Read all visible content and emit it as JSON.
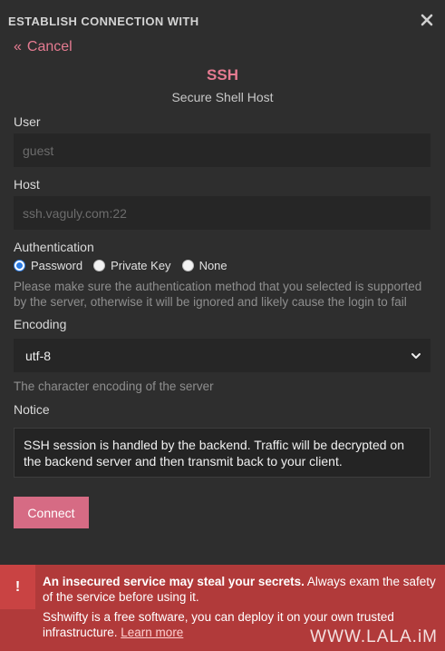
{
  "header": {
    "title": "ESTABLISH CONNECTION WITH"
  },
  "nav": {
    "cancel_chevron": "«",
    "cancel_label": "Cancel"
  },
  "protocol": {
    "name": "SSH",
    "description": "Secure Shell Host"
  },
  "fields": {
    "user": {
      "label": "User",
      "placeholder": "guest"
    },
    "host": {
      "label": "Host",
      "placeholder": "ssh.vaguly.com:22"
    }
  },
  "authentication": {
    "label": "Authentication",
    "options": [
      "Password",
      "Private Key",
      "None"
    ],
    "selected": "Password",
    "help": "Please make sure the authentication method that you selected is supported by the server, otherwise it will be ignored and likely cause the login to fail"
  },
  "encoding": {
    "label": "Encoding",
    "selected": "utf-8",
    "help": "The character encoding of the server"
  },
  "notice": {
    "label": "Notice",
    "text": "SSH session is handled by the backend. Traffic will be decrypted on the backend server and then transmit back to your client."
  },
  "actions": {
    "connect_label": "Connect"
  },
  "warning": {
    "icon": "!",
    "strong": "An insecured service may steal your secrets.",
    "text": " Always exam the safety of the service before using it.",
    "text2": "Sshwifty is a free software, you can deploy it on your own trusted infrastructure. ",
    "learn_more": "Learn more"
  },
  "watermark": "WWW.LALA.iM",
  "colors": {
    "accent": "#e57b91",
    "button": "#d66b84",
    "warning_bg": "#b13a3a",
    "radio_on": "#2a7ae2"
  }
}
